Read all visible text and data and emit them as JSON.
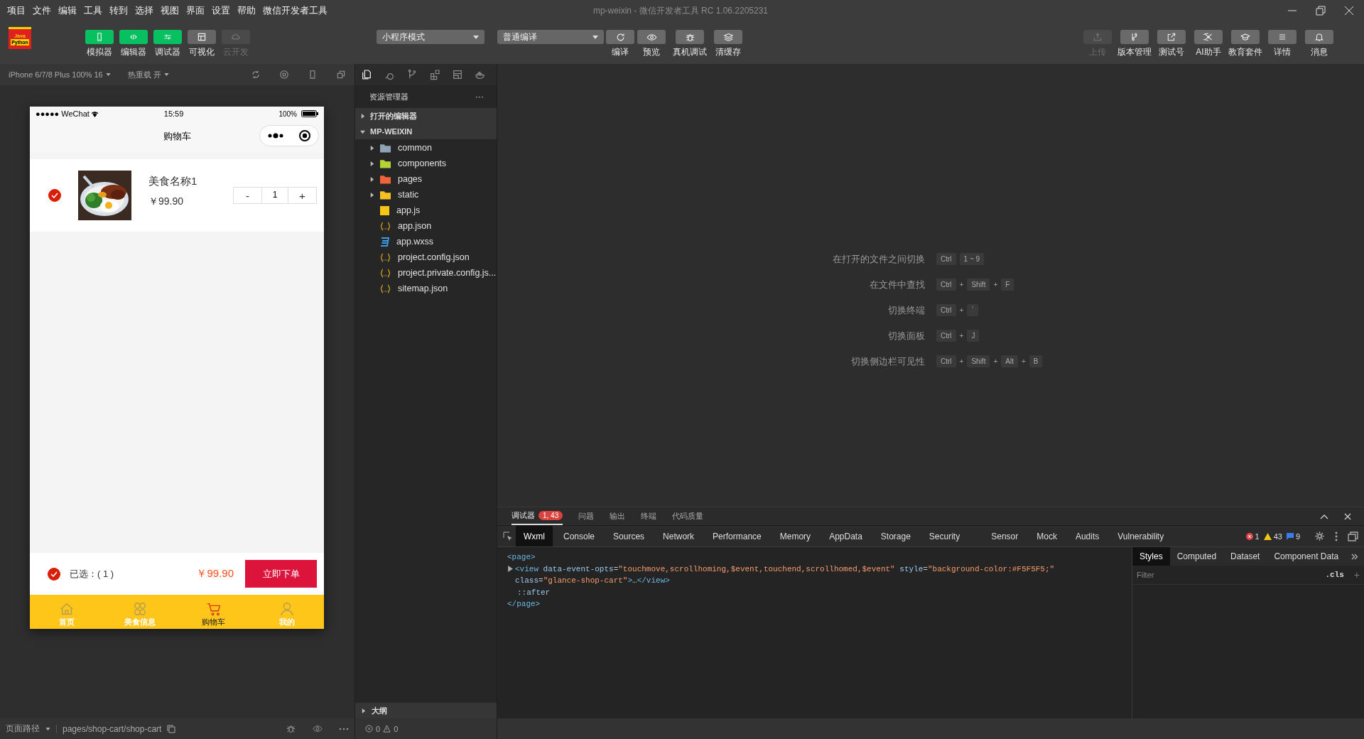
{
  "menu": [
    "项目",
    "文件",
    "编辑",
    "工具",
    "转到",
    "选择",
    "视图",
    "界面",
    "设置",
    "帮助",
    "微信开发者工具"
  ],
  "window": {
    "title": "mp-weixin - 微信开发者工具 RC 1.06.2205231"
  },
  "logo": {
    "line1": "Java",
    "line2": "Python"
  },
  "toolbar": {
    "modes": [
      {
        "label": "模拟器",
        "on": true,
        "disabled": false
      },
      {
        "label": "编辑器",
        "on": true,
        "disabled": false
      },
      {
        "label": "调试器",
        "on": true,
        "disabled": false
      },
      {
        "label": "可视化",
        "on": false,
        "disabled": false
      },
      {
        "label": "云开发",
        "on": false,
        "disabled": true
      }
    ],
    "mode_select": "小程序模式",
    "compile_select": "普通编译",
    "actions": [
      {
        "label": "编译"
      },
      {
        "label": "预览"
      },
      {
        "label": "真机调试"
      },
      {
        "label": "清缓存"
      }
    ],
    "right": [
      {
        "label": "上传",
        "disabled": true
      },
      {
        "label": "版本管理",
        "disabled": false
      },
      {
        "label": "测试号",
        "disabled": false
      },
      {
        "label": "AI助手",
        "disabled": false
      },
      {
        "label": "教育套件",
        "disabled": false
      },
      {
        "label": "详情",
        "disabled": false
      },
      {
        "label": "消息",
        "disabled": false
      }
    ]
  },
  "simulator": {
    "device": "iPhone 6/7/8 Plus 100% 16",
    "hot_reload": "热重载 开",
    "phone": {
      "carrier": "●●●●● WeChat",
      "time": "15:59",
      "battery": "100%",
      "nav_title": "购物车",
      "item": {
        "checked": true,
        "name": "美食名称1",
        "price": "￥99.90",
        "minus": "-",
        "quantity": "1",
        "plus": "+"
      },
      "footer": {
        "checked": true,
        "selected_label": "已选：( 1 )",
        "total": "￥99.90",
        "order_button": "立即下单"
      },
      "tabs": [
        {
          "label": "首页",
          "selected": false
        },
        {
          "label": "美食信息",
          "selected": false
        },
        {
          "label": "购物车",
          "selected": true
        },
        {
          "label": "我的",
          "selected": false
        }
      ]
    }
  },
  "explorer": {
    "title": "资源管理器",
    "more": "···",
    "sections": [
      {
        "label": "打开的编辑器",
        "expanded": false
      },
      {
        "label": "MP-WEIXIN",
        "expanded": true
      }
    ],
    "files": [
      {
        "name": "common",
        "kind": "folder",
        "color": "#8ea3b5"
      },
      {
        "name": "components",
        "kind": "folder",
        "color": "#b5d334"
      },
      {
        "name": "pages",
        "kind": "folder",
        "color": "#f0643c"
      },
      {
        "name": "static",
        "kind": "folder",
        "color": "#f5c023"
      },
      {
        "name": "app.js",
        "kind": "js"
      },
      {
        "name": "app.json",
        "kind": "json"
      },
      {
        "name": "app.wxss",
        "kind": "css"
      },
      {
        "name": "project.config.json",
        "kind": "json"
      },
      {
        "name": "project.private.config.js...",
        "kind": "json"
      },
      {
        "name": "sitemap.json",
        "kind": "json"
      }
    ],
    "outline": "大纲",
    "errors": "0",
    "warnings": "0"
  },
  "shortcuts": [
    {
      "label": "在打开的文件之间切换",
      "keys": [
        {
          "text": "Ctrl",
          "kind": "key"
        },
        {
          "text": "1 ~ 9",
          "kind": "key"
        }
      ]
    },
    {
      "label": "在文件中查找",
      "keys": [
        {
          "text": "Ctrl",
          "kind": "key"
        },
        {
          "text": "+",
          "kind": "sep"
        },
        {
          "text": "Shift",
          "kind": "key"
        },
        {
          "text": "+",
          "kind": "sep"
        },
        {
          "text": "F",
          "kind": "key"
        }
      ]
    },
    {
      "label": "切换终端",
      "keys": [
        {
          "text": "Ctrl",
          "kind": "key"
        },
        {
          "text": "+",
          "kind": "sep"
        },
        {
          "text": "`",
          "kind": "key"
        }
      ]
    },
    {
      "label": "切换面板",
      "keys": [
        {
          "text": "Ctrl",
          "kind": "key"
        },
        {
          "text": "+",
          "kind": "sep"
        },
        {
          "text": "J",
          "kind": "key"
        }
      ]
    },
    {
      "label": "切换侧边栏可见性",
      "keys": [
        {
          "text": "Ctrl",
          "kind": "key"
        },
        {
          "text": "+",
          "kind": "sep"
        },
        {
          "text": "Shift",
          "kind": "key"
        },
        {
          "text": "+",
          "kind": "sep"
        },
        {
          "text": "Alt",
          "kind": "key"
        },
        {
          "text": "+",
          "kind": "sep"
        },
        {
          "text": "B",
          "kind": "key"
        }
      ]
    }
  ],
  "devtools": {
    "panels": [
      {
        "label": "调试器",
        "selected": true,
        "badge": "1, 43"
      },
      {
        "label": "问题",
        "selected": false
      },
      {
        "label": "输出",
        "selected": false
      },
      {
        "label": "终端",
        "selected": false
      },
      {
        "label": "代码质量",
        "selected": false
      }
    ],
    "tabs": [
      {
        "label": "Wxml",
        "selected": true
      },
      {
        "label": "Console",
        "selected": false
      },
      {
        "label": "Sources",
        "selected": false
      },
      {
        "label": "Network",
        "selected": false
      },
      {
        "label": "Performance",
        "selected": false
      },
      {
        "label": "Memory",
        "selected": false
      },
      {
        "label": "AppData",
        "selected": false
      },
      {
        "label": "Storage",
        "selected": false
      },
      {
        "label": "Security",
        "selected": false
      },
      {
        "label": "Sensor",
        "selected": false
      },
      {
        "label": "Mock",
        "selected": false
      },
      {
        "label": "Audits",
        "selected": false
      },
      {
        "label": "Vulnerability",
        "selected": false
      }
    ],
    "counts": {
      "errors": "1",
      "warnings": "43",
      "info": "9"
    },
    "dom": {
      "open": [
        {
          "text": "<page>",
          "kind": "tag"
        }
      ],
      "children": [
        {
          "kind": "element",
          "expanded": false,
          "tokens": [
            {
              "text": "<view",
              "kind": "tag"
            },
            {
              "text": " data-event-opts",
              "kind": "attr"
            },
            {
              "text": "=",
              "kind": "plain"
            },
            {
              "text": "\"touchmove,scrollhoming,$event,touchend,scrollhomed,$event\"",
              "kind": "value"
            },
            {
              "text": " style",
              "kind": "attr"
            },
            {
              "text": "=",
              "kind": "plain"
            },
            {
              "text": "\"background-color:#F5F5F5;\"",
              "kind": "value"
            },
            {
              "text": " class",
              "kind": "attr"
            },
            {
              "text": "=",
              "kind": "plain"
            },
            {
              "text": "\"glance-shop-cart\"",
              "kind": "value"
            },
            {
              "text": ">",
              "kind": "tag"
            },
            {
              "text": "…",
              "kind": "plain"
            },
            {
              "text": "</view>",
              "kind": "tag"
            }
          ]
        },
        {
          "kind": "pseudo",
          "tokens": [
            {
              "text": "::after",
              "kind": "attr"
            }
          ]
        }
      ],
      "close": [
        {
          "text": "</page>",
          "kind": "tag"
        }
      ]
    },
    "side_tabs": [
      {
        "label": "Styles",
        "selected": true
      },
      {
        "label": "Computed",
        "selected": false
      },
      {
        "label": "Dataset",
        "selected": false
      },
      {
        "label": "Component Data",
        "selected": false
      }
    ],
    "filter": {
      "placeholder": "Filter"
    },
    "cls": ".cls",
    "add": "+"
  },
  "status": {
    "path_label": "页面路径",
    "path": "pages/shop-cart/shop-cart"
  }
}
